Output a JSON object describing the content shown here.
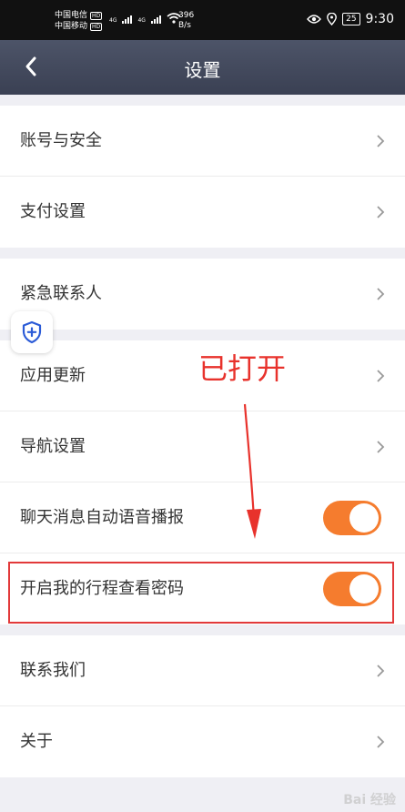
{
  "status_bar": {
    "carrier1": "中国电信",
    "carrier2": "中国移动",
    "hd": "HD",
    "net1": "4G",
    "net2": "4G",
    "speed_value": "396",
    "speed_unit": "B/s",
    "battery": "25",
    "time": "9:30"
  },
  "header": {
    "title": "设置"
  },
  "groups": [
    {
      "items": [
        {
          "label": "账号与安全"
        },
        {
          "label": "支付设置"
        }
      ]
    },
    {
      "items": [
        {
          "label": "紧急联系人"
        }
      ]
    },
    {
      "items": [
        {
          "label": "应用更新"
        },
        {
          "label": "导航设置"
        },
        {
          "label": "聊天消息自动语音播报",
          "toggle_on": true
        },
        {
          "label": "开启我的行程查看密码",
          "toggle_on": true
        }
      ]
    },
    {
      "items": [
        {
          "label": "联系我们"
        },
        {
          "label": "关于"
        }
      ]
    }
  ],
  "annotation": {
    "text": "已打开"
  },
  "watermark": {
    "text": "Bai 经验"
  },
  "colors": {
    "toggle": "#f57c2e",
    "header": "#434a5e",
    "annotation": "#e8322c"
  }
}
